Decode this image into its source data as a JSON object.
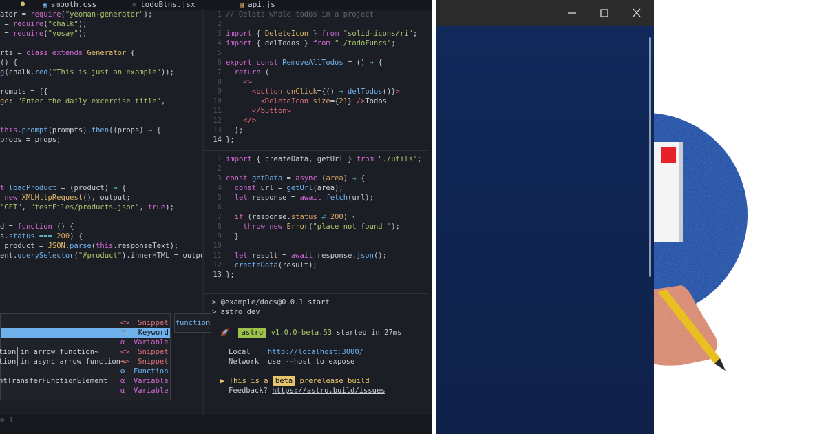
{
  "editor": {
    "tabs": [
      {
        "name": "smooth.css",
        "icon": "css-file-icon",
        "glyph": "▣"
      },
      {
        "name": "todoBtns.jsx",
        "icon": "react-file-icon",
        "glyph": "⚛"
      },
      {
        "name": "api.js",
        "icon": "js-file-icon",
        "glyph": "▤"
      }
    ],
    "modified_dot": "●",
    "left_pane": {
      "lines": [
        [
          [
            "p",
            "ator = "
          ],
          [
            "k",
            "require"
          ],
          [
            "p",
            "("
          ],
          [
            "s",
            "\"yeoman-generator\""
          ],
          [
            "p",
            ");"
          ]
        ],
        [
          [
            "p",
            " = "
          ],
          [
            "k",
            "require"
          ],
          [
            "p",
            "("
          ],
          [
            "s",
            "\"chalk\""
          ],
          [
            "p",
            ");"
          ]
        ],
        [
          [
            "p",
            " = "
          ],
          [
            "k",
            "require"
          ],
          [
            "p",
            "("
          ],
          [
            "s",
            "\"yosay\""
          ],
          [
            "p",
            ");"
          ]
        ],
        [],
        [
          [
            "p",
            "rts = "
          ],
          [
            "k",
            "class extends "
          ],
          [
            "cls",
            "Generator"
          ],
          [
            "p",
            " {"
          ]
        ],
        [
          [
            "p",
            "() {"
          ]
        ],
        [
          [
            "fn",
            "g"
          ],
          [
            "p",
            "(chalk."
          ],
          [
            "fn",
            "red"
          ],
          [
            "p",
            "("
          ],
          [
            "s",
            "\"This is just an example\""
          ],
          [
            "p",
            "));"
          ]
        ],
        [],
        [
          [
            "p",
            "rompts = [{"
          ]
        ],
        [
          [
            "at",
            "ge"
          ],
          [
            "p",
            ": "
          ],
          [
            "s",
            "\"Enter the daily excercise title\""
          ],
          [
            "p",
            ","
          ]
        ],
        [],
        [],
        [
          [
            "k",
            "this"
          ],
          [
            "p",
            "."
          ],
          [
            "fn",
            "prompt"
          ],
          [
            "p",
            "(prompts)."
          ],
          [
            "fn",
            "then"
          ],
          [
            "p",
            "((props) "
          ],
          [
            "op",
            "⇒"
          ],
          [
            "p",
            " {"
          ]
        ],
        [
          [
            "p",
            "props = props;"
          ]
        ],
        [],
        [],
        [],
        [],
        [
          [
            "k",
            "t "
          ],
          [
            "fn",
            "loadProduct"
          ],
          [
            "p",
            " = (product) "
          ],
          [
            "op",
            "⇒"
          ],
          [
            "p",
            " {"
          ]
        ],
        [
          [
            "k",
            " new "
          ],
          [
            "cls",
            "XMLHttpRequest"
          ],
          [
            "p",
            "(), output;"
          ]
        ],
        [
          [
            "s",
            "\"GET\""
          ],
          [
            "p",
            ", "
          ],
          [
            "s",
            "\"testFiles/products.json\""
          ],
          [
            "p",
            ", "
          ],
          [
            "k",
            "true"
          ],
          [
            "p",
            ");"
          ]
        ],
        [],
        [
          [
            "p",
            "d = "
          ],
          [
            "k",
            "function"
          ],
          [
            "p",
            " () {"
          ]
        ],
        [
          [
            "p",
            "s."
          ],
          [
            "fn",
            "status"
          ],
          [
            "p",
            " "
          ],
          [
            "op",
            "==="
          ],
          [
            "p",
            " "
          ],
          [
            "num",
            "200"
          ],
          [
            "p",
            ") {"
          ]
        ],
        [
          [
            "p",
            " product = "
          ],
          [
            "cls",
            "JSON"
          ],
          [
            "p",
            "."
          ],
          [
            "fn",
            "parse"
          ],
          [
            "p",
            "("
          ],
          [
            "k",
            "this"
          ],
          [
            "p",
            ".responseText);"
          ]
        ],
        [
          [
            "p",
            "ent."
          ],
          [
            "fn",
            "querySelector"
          ],
          [
            "p",
            "("
          ],
          [
            "s",
            "\"#product\""
          ],
          [
            "p",
            ").innerHTML = output;"
          ]
        ]
      ]
    },
    "right_top": {
      "line_numbers": [
        "1",
        "2",
        "3",
        "4",
        "5",
        "6",
        "7",
        "8",
        "9",
        "10",
        "11",
        "12",
        "13",
        "14"
      ],
      "current_line": "14",
      "lines": [
        [
          [
            "cm",
            "// Delets whole todos in a project"
          ]
        ],
        [],
        [
          [
            "k",
            "import"
          ],
          [
            "p",
            " { "
          ],
          [
            "cls",
            "DeleteIcon"
          ],
          [
            "p",
            " } "
          ],
          [
            "k",
            "from"
          ],
          [
            "p",
            " "
          ],
          [
            "s",
            "\"solid-icons/ri\""
          ],
          [
            "p",
            ";"
          ]
        ],
        [
          [
            "k",
            "import"
          ],
          [
            "p",
            " { delTodos } "
          ],
          [
            "k",
            "from"
          ],
          [
            "p",
            " "
          ],
          [
            "s",
            "\"./todoFuncs\""
          ],
          [
            "p",
            ";"
          ]
        ],
        [],
        [
          [
            "k",
            "export const "
          ],
          [
            "fn",
            "RemoveAllTodos"
          ],
          [
            "p",
            " = () "
          ],
          [
            "op",
            "⇒"
          ],
          [
            "p",
            " {"
          ]
        ],
        [
          [
            "k",
            "  return"
          ],
          [
            "p",
            " ("
          ]
        ],
        [
          [
            "tg",
            "    <>"
          ]
        ],
        [
          [
            "tg",
            "      <button "
          ],
          [
            "at",
            "onClick"
          ],
          [
            "p",
            "={() "
          ],
          [
            "op",
            "⇒"
          ],
          [
            "p",
            " "
          ],
          [
            "fn",
            "delTodos"
          ],
          [
            "p",
            "()}"
          ],
          [
            "tg",
            ">"
          ]
        ],
        [
          [
            "tg",
            "        <DeleteIcon "
          ],
          [
            "at",
            "size"
          ],
          [
            "p",
            "={"
          ],
          [
            "num",
            "21"
          ],
          [
            "p",
            "} "
          ],
          [
            "tg",
            "/>"
          ],
          [
            "p",
            "Todos"
          ]
        ],
        [
          [
            "tg",
            "      </button>"
          ]
        ],
        [
          [
            "tg",
            "    </>"
          ]
        ],
        [
          [
            "p",
            "  );"
          ]
        ],
        [
          [
            "p",
            "};"
          ]
        ]
      ]
    },
    "right_bottom": {
      "line_numbers": [
        "1",
        "2",
        "3",
        "4",
        "5",
        "6",
        "7",
        "8",
        "9",
        "10",
        "11",
        "12",
        "13"
      ],
      "current_line": "13",
      "lines": [
        [
          [
            "k",
            "import"
          ],
          [
            "p",
            " { createData, getUrl } "
          ],
          [
            "k",
            "from"
          ],
          [
            "p",
            " "
          ],
          [
            "s",
            "\"./utils\""
          ],
          [
            "p",
            ";"
          ]
        ],
        [],
        [
          [
            "k",
            "const "
          ],
          [
            "fn",
            "getData"
          ],
          [
            "p",
            " = "
          ],
          [
            "k",
            "async"
          ],
          [
            "p",
            " ("
          ],
          [
            "at",
            "area"
          ],
          [
            "p",
            ") "
          ],
          [
            "op",
            "⇒"
          ],
          [
            "p",
            " {"
          ]
        ],
        [
          [
            "k",
            "  const"
          ],
          [
            "p",
            " url = "
          ],
          [
            "fn",
            "getUrl"
          ],
          [
            "p",
            "(area);"
          ]
        ],
        [
          [
            "k",
            "  let"
          ],
          [
            "p",
            " response = "
          ],
          [
            "k",
            "await "
          ],
          [
            "fn",
            "fetch"
          ],
          [
            "p",
            "(url);"
          ]
        ],
        [],
        [
          [
            "k",
            "  if"
          ],
          [
            "p",
            " (response."
          ],
          [
            "at",
            "status"
          ],
          [
            "p",
            " "
          ],
          [
            "op",
            "≠"
          ],
          [
            "p",
            " "
          ],
          [
            "num",
            "200"
          ],
          [
            "p",
            ") {"
          ]
        ],
        [
          [
            "k",
            "    throw new "
          ],
          [
            "cls",
            "Error"
          ],
          [
            "p",
            "("
          ],
          [
            "s",
            "\"place not found \""
          ],
          [
            "p",
            ");"
          ]
        ],
        [
          [
            "p",
            "  }"
          ]
        ],
        [],
        [
          [
            "k",
            "  let"
          ],
          [
            "p",
            " result = "
          ],
          [
            "k",
            "await"
          ],
          [
            "p",
            " response."
          ],
          [
            "fn",
            "json"
          ],
          [
            "p",
            "();"
          ]
        ],
        [
          [
            "fn",
            "  createData"
          ],
          [
            "p",
            "(result);"
          ]
        ],
        [
          [
            "p",
            "};"
          ]
        ]
      ]
    },
    "autocomplete": {
      "items": [
        {
          "label": "",
          "kind": "Snippet",
          "kind_icon": "<>",
          "kind_class": "kind-snippet",
          "selected": false
        },
        {
          "label": "",
          "kind": "Keyword",
          "kind_icon": "🔧",
          "kind_class": "kind-keyword",
          "selected": true
        },
        {
          "label": "",
          "kind": "Variable",
          "kind_icon": "α",
          "kind_class": "kind-variable",
          "selected": false
        },
        {
          "label": "tion in arrow function~",
          "kind": "Snippet",
          "kind_icon": "<>",
          "kind_class": "kind-snippet",
          "selected": false
        },
        {
          "label": "tion in async arrow function~",
          "kind": "Snippet",
          "kind_icon": "<>",
          "kind_class": "kind-snippet",
          "selected": false
        },
        {
          "label": "",
          "kind": "Function",
          "kind_icon": "⚙",
          "kind_class": "kind-function",
          "selected": false
        },
        {
          "label": "ntTransferFunctionElement",
          "kind": "Variable",
          "kind_icon": "α",
          "kind_class": "kind-variable",
          "selected": false
        },
        {
          "label": "",
          "kind": "Variable",
          "kind_icon": "α",
          "kind_class": "kind-variable",
          "selected": false
        }
      ],
      "detail": "function"
    },
    "terminal": {
      "prompt_line_1": "> @example/docs@0.0.1 start",
      "prompt_line_2": "> astro dev",
      "rocket": "🚀",
      "astro_badge": "astro",
      "version_text": "v1.0.0-beta.53",
      "started_text": "started in 27ms",
      "local_label": "Local",
      "local_url": "http://localhost:3000/",
      "network_label": "Network",
      "network_value": "use --host to expose",
      "arrow": "▶",
      "prerelease_prefix": "This is a",
      "beta_badge": "beta",
      "prerelease_suffix": "prerelease build",
      "feedback_label": "Feedback?",
      "feedback_url": "https://astro.build/issues"
    },
    "status_text": "⊗ 1"
  },
  "colors": {
    "editor_bg": "#1b1e24",
    "app_bg": "#112a5c",
    "titlebar_bg": "#2b2b2b",
    "illustration_blue": "#1247a8",
    "accent_red": "#e8202a",
    "hand": "#e0876a",
    "pencil_yellow": "#e8c020"
  }
}
